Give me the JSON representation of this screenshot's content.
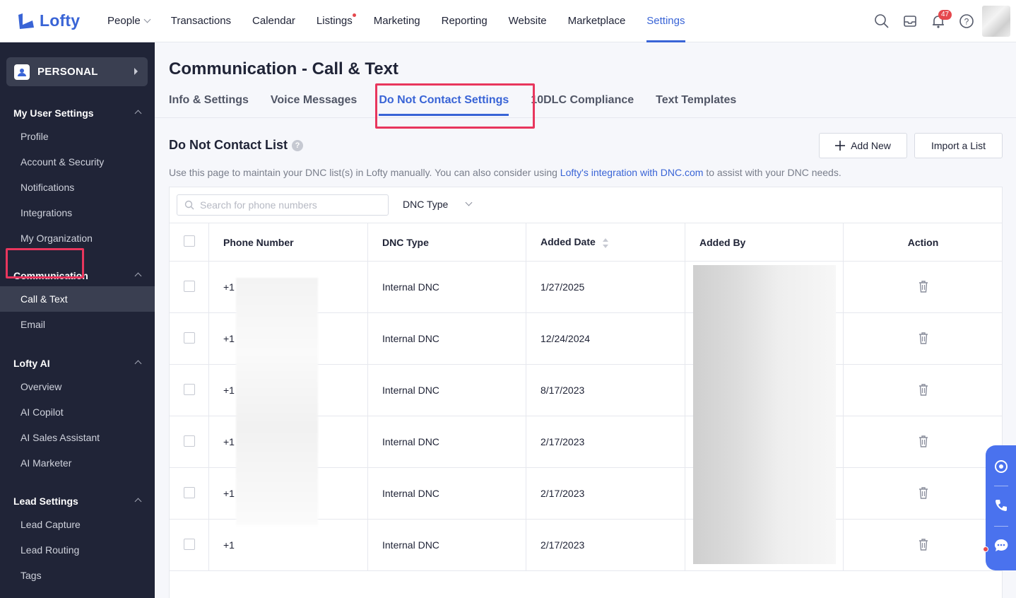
{
  "brand": {
    "name": "Lofty",
    "accent": "#3964d6",
    "sidebar_bg": "#202437",
    "highlight": "#e8365d"
  },
  "nav": {
    "items": [
      {
        "label": "People",
        "has_caret": true
      },
      {
        "label": "Transactions"
      },
      {
        "label": "Calendar"
      },
      {
        "label": "Listings",
        "has_dot": true
      },
      {
        "label": "Marketing"
      },
      {
        "label": "Reporting"
      },
      {
        "label": "Website"
      },
      {
        "label": "Marketplace"
      },
      {
        "label": "Settings",
        "active": true
      }
    ],
    "icons": [
      "search-icon",
      "inbox-icon",
      "bell-icon",
      "help-icon"
    ],
    "notification_count": "47"
  },
  "sidebar": {
    "personal_label": "PERSONAL",
    "sections": [
      {
        "title": "My User Settings",
        "items": [
          "Profile",
          "Account & Security",
          "Notifications",
          "Integrations",
          "My Organization"
        ]
      },
      {
        "title": "Communication",
        "items": [
          "Call & Text",
          "Email"
        ]
      },
      {
        "title": "Lofty AI",
        "items": [
          "Overview",
          "AI Copilot",
          "AI Sales Assistant",
          "AI Marketer"
        ]
      },
      {
        "title": "Lead Settings",
        "items": [
          "Lead Capture",
          "Lead Routing",
          "Tags"
        ]
      }
    ],
    "active_item": "Call & Text"
  },
  "main": {
    "title": "Communication - Call & Text",
    "tabs": [
      "Info & Settings",
      "Voice Messages",
      "Do Not Contact Settings",
      "10DLC Compliance",
      "Text Templates"
    ],
    "active_tab": "Do Not Contact Settings",
    "list_title": "Do Not Contact List",
    "add_new_label": "Add New",
    "import_label": "Import a List",
    "description_before": "Use this page to maintain your DNC list(s) in Lofty manually. You can also consider using ",
    "description_link": "Lofty's integration with DNC.com",
    "description_after": " to assist with your DNC needs.",
    "search_placeholder": "Search for phone numbers",
    "filter_label": "DNC Type",
    "columns": [
      "Phone Number",
      "DNC Type",
      "Added Date",
      "Added By",
      "Action"
    ],
    "rows": [
      {
        "phone": "+1",
        "type": "Internal DNC",
        "date": "1/27/2025"
      },
      {
        "phone": "+1",
        "type": "Internal DNC",
        "date": "12/24/2024"
      },
      {
        "phone": "+1",
        "type": "Internal DNC",
        "date": "8/17/2023"
      },
      {
        "phone": "+1",
        "type": "Internal DNC",
        "date": "2/17/2023"
      },
      {
        "phone": "+1",
        "type": "Internal DNC",
        "date": "2/17/2023"
      },
      {
        "phone": "+1",
        "type": "Internal DNC",
        "date": "2/17/2023"
      }
    ]
  }
}
